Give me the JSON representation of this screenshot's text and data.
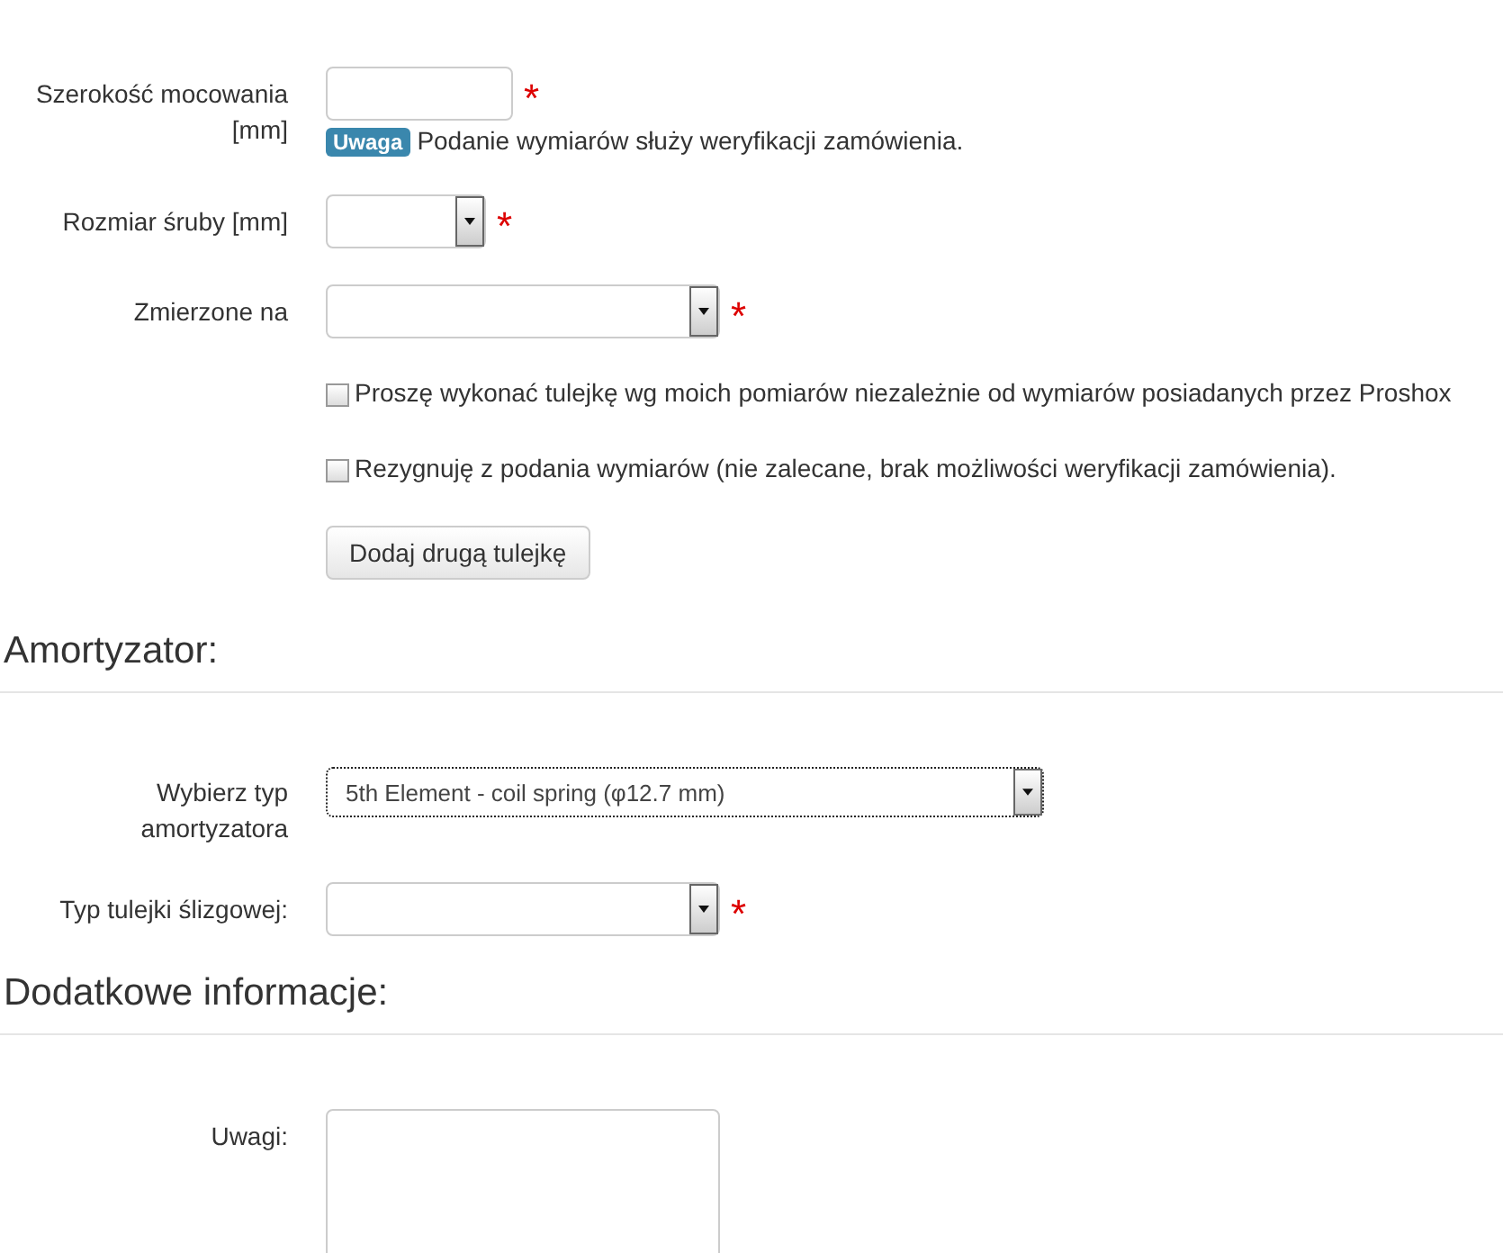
{
  "sections": [
    {
      "rows": [
        {
          "kind": "text",
          "label": "Szerokość mocowania [mm]",
          "value": "",
          "required_mark": "*",
          "note": {
            "badge": "Uwaga",
            "text": "Podanie wymiarów służy weryfikacji zamówienia."
          }
        },
        {
          "kind": "select",
          "label": "Rozmiar śruby [mm]",
          "value": "",
          "required_mark": "*"
        },
        {
          "kind": "select",
          "label": "Zmierzone na",
          "value": "",
          "required_mark": "*"
        },
        {
          "kind": "checkbox",
          "text": "Proszę wykonać tulejkę wg moich pomiarów niezależnie od wymiarów posiadanych przez Proshox",
          "checked": false
        },
        {
          "kind": "checkbox",
          "text": "Rezygnuję z podania wymiarów (nie zalecane, brak możliwości weryfikacji zamówienia).",
          "checked": false
        },
        {
          "kind": "button",
          "text": "Dodaj drugą tulejkę"
        }
      ]
    },
    {
      "heading": "Amortyzator:",
      "rows": [
        {
          "kind": "select",
          "label": "Wybierz typ amortyzatora",
          "value": "5th Element - coil spring (φ12.7 mm)",
          "focused": true
        },
        {
          "kind": "select",
          "label": "Typ tulejki ślizgowej:",
          "value": "",
          "required_mark": "*"
        }
      ]
    },
    {
      "heading": "Dodatkowe informacje:",
      "rows": [
        {
          "kind": "textarea",
          "label": "Uwagi:",
          "value": ""
        }
      ]
    }
  ]
}
